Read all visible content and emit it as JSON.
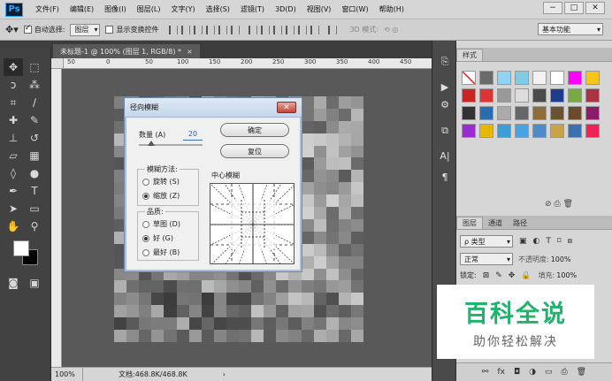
{
  "menubar": {
    "logo": "Ps",
    "items": [
      "文件(F)",
      "编辑(E)",
      "图像(I)",
      "图层(L)",
      "文字(Y)",
      "选择(S)",
      "滤镜(T)",
      "3D(D)",
      "视图(V)",
      "窗口(W)",
      "帮助(H)"
    ]
  },
  "optionsbar": {
    "auto_select_label": "自动选择:",
    "auto_select_value": "图层",
    "show_transform_label": "显示变换控件",
    "mode_3d_label": "3D 模式:",
    "workspace": "基本功能"
  },
  "document": {
    "tab_title": "未标题-1 @ 100% (图层 1, RGB/8) *",
    "ruler_ticks": [
      "50",
      "0",
      "50",
      "100",
      "150",
      "200",
      "250",
      "300",
      "350",
      "400",
      "450"
    ],
    "zoom": "100%",
    "doc_size": "文档:468.8K/468.8K"
  },
  "canvas_pixels": [
    "#6a6a6a",
    "#5c5c5c",
    "#4e4e4e",
    "#636363",
    "#7a7a7a",
    "#6c6c6c",
    "#555",
    "#4a4a4a",
    "#5f5f5f",
    "#777",
    "#8a8a8a",
    "#9a9a9a",
    "#a3a3a3",
    "#8c8c8c",
    "#7d7d7d",
    "#9e9e9e",
    "#b3b3b3",
    "#a0a0a0",
    "#8a8a8a",
    "#7a7a7a"
  ],
  "dialog": {
    "title": "径向模糊",
    "amount_label": "数量 (A)",
    "amount_value": "20",
    "ok": "确定",
    "reset": "复位",
    "method_title": "模糊方法:",
    "method_spin": "旋转 (S)",
    "method_zoom": "缩放 (Z)",
    "quality_title": "品质:",
    "quality_draft": "草图 (D)",
    "quality_good": "好 (G)",
    "quality_best": "最好 (B)",
    "center_label": "中心模糊",
    "amount_fraction": 0.2
  },
  "styles_panel": {
    "tab": "样式"
  },
  "layers_panel": {
    "tabs": [
      "图层",
      "通道",
      "路径"
    ],
    "filter": "ρ 类型",
    "blend_mode": "正常",
    "opacity_label": "不透明度:",
    "opacity_value": "100%",
    "lock_label": "锁定:",
    "fill_label": "填充:",
    "fill_value": "100%"
  },
  "watermark": {
    "title": "百科全说",
    "subtitle": "助你轻松解决"
  }
}
